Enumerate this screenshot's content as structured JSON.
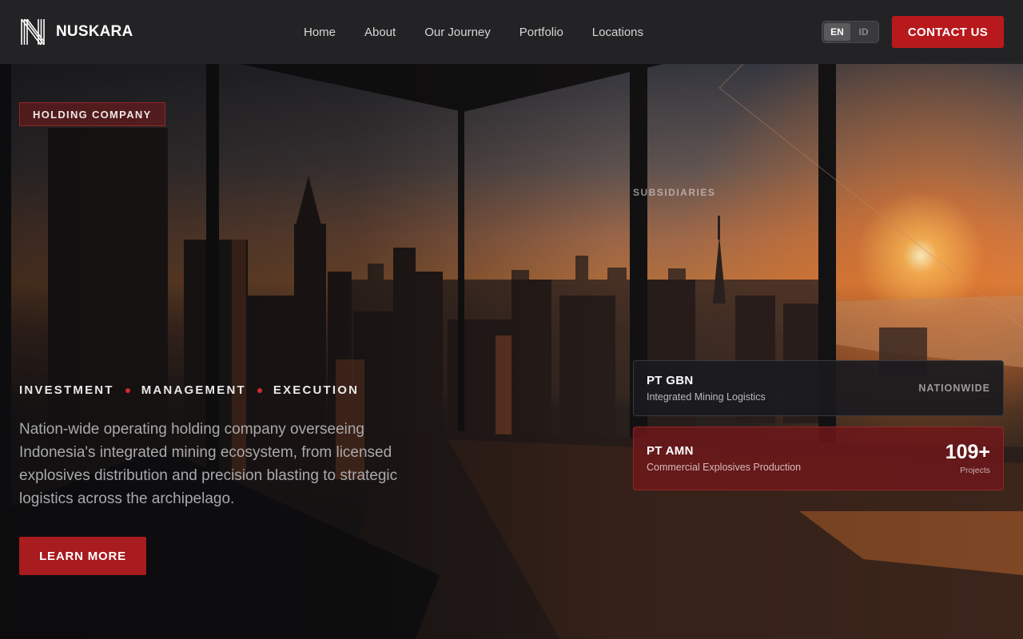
{
  "brand": {
    "name": "NUSKARA"
  },
  "nav": {
    "items": [
      {
        "label": "Home"
      },
      {
        "label": "About"
      },
      {
        "label": "Our Journey"
      },
      {
        "label": "Portfolio"
      },
      {
        "label": "Locations"
      }
    ]
  },
  "language": {
    "options": [
      "EN",
      "ID"
    ],
    "selected": "EN"
  },
  "header": {
    "contact_label": "CONTACT US"
  },
  "hero": {
    "badge": "HOLDING COMPANY",
    "pillars": [
      "INVESTMENT",
      "MANAGEMENT",
      "EXECUTION"
    ],
    "tagline": "Nation-wide operating holding company overseeing Indonesia's integrated mining ecosystem, from licensed explosives distribution and precision blasting to strategic logistics across the archipelago.",
    "cta_label": "LEARN MORE"
  },
  "subsidiaries": {
    "label": "SUBSIDIARIES",
    "items": [
      {
        "name": "PT GBN",
        "description": "Integrated Mining Logistics",
        "region": "NATIONWIDE"
      },
      {
        "name": "PT AMN",
        "description": "Commercial Explosives Production",
        "stat_value": "109+",
        "stat_label": "Projects"
      }
    ]
  },
  "colors": {
    "accent": "#b8191c",
    "header_bg": "#232325",
    "card_dark": "#1a1a1e",
    "card_red": "#6e181a"
  },
  "icons": {
    "logo": "nuskara-n-logo",
    "pillar_separator": "red-dot"
  }
}
